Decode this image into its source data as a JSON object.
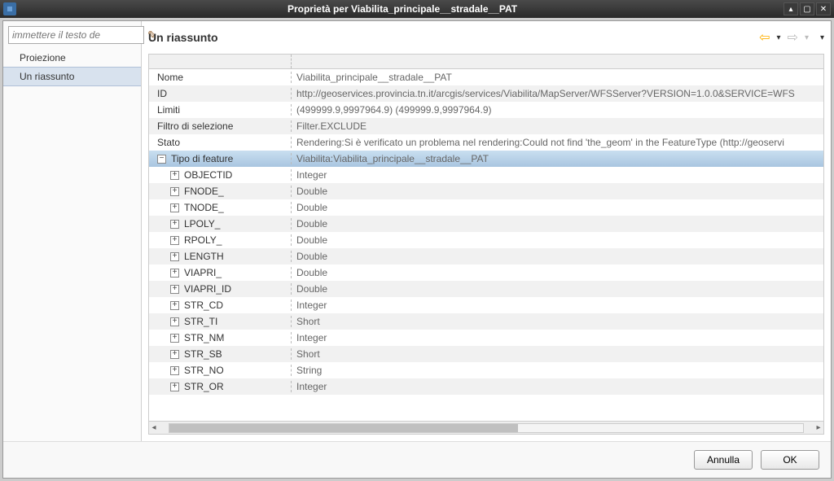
{
  "window": {
    "title": "Proprietà per Viabilita_principale__stradale__PAT"
  },
  "sidebar": {
    "search_placeholder": "immettere il testo de",
    "items": [
      {
        "label": "Proiezione",
        "selected": false
      },
      {
        "label": "Un riassunto",
        "selected": true
      }
    ]
  },
  "main": {
    "title": "Un riassunto",
    "rows": [
      {
        "label": "Nome",
        "value": "Viabilita_principale__stradale__PAT",
        "expander": "",
        "indent": 0
      },
      {
        "label": "ID",
        "value": "http://geoservices.provincia.tn.it/arcgis/services/Viabilita/MapServer/WFSServer?VERSION=1.0.0&SERVICE=WFS",
        "expander": "",
        "indent": 0
      },
      {
        "label": "Limiti",
        "value": "(499999.9,9997964.9) (499999.9,9997964.9)",
        "expander": "",
        "indent": 0
      },
      {
        "label": "Filtro di selezione",
        "value": "Filter.EXCLUDE",
        "expander": "",
        "indent": 0
      },
      {
        "label": "Stato",
        "value": "Rendering:Si è verificato un problema nel rendering:Could not find 'the_geom' in the FeatureType (http://geoservi",
        "expander": "",
        "indent": 0
      },
      {
        "label": "Tipo di feature",
        "value": "Viabilita:Viabilita_principale__stradale__PAT",
        "expander": "−",
        "indent": 0,
        "highlight": true
      },
      {
        "label": "OBJECTID",
        "value": "Integer",
        "expander": "+",
        "indent": 1
      },
      {
        "label": "FNODE_",
        "value": "Double",
        "expander": "+",
        "indent": 1
      },
      {
        "label": "TNODE_",
        "value": "Double",
        "expander": "+",
        "indent": 1
      },
      {
        "label": "LPOLY_",
        "value": "Double",
        "expander": "+",
        "indent": 1
      },
      {
        "label": "RPOLY_",
        "value": "Double",
        "expander": "+",
        "indent": 1
      },
      {
        "label": "LENGTH",
        "value": "Double",
        "expander": "+",
        "indent": 1
      },
      {
        "label": "VIAPRI_",
        "value": "Double",
        "expander": "+",
        "indent": 1
      },
      {
        "label": "VIAPRI_ID",
        "value": "Double",
        "expander": "+",
        "indent": 1
      },
      {
        "label": "STR_CD",
        "value": "Integer",
        "expander": "+",
        "indent": 1
      },
      {
        "label": "STR_TI",
        "value": "Short",
        "expander": "+",
        "indent": 1
      },
      {
        "label": "STR_NM",
        "value": "Integer",
        "expander": "+",
        "indent": 1
      },
      {
        "label": "STR_SB",
        "value": "Short",
        "expander": "+",
        "indent": 1
      },
      {
        "label": "STR_NO",
        "value": "String",
        "expander": "+",
        "indent": 1
      },
      {
        "label": "STR_OR",
        "value": "Integer",
        "expander": "+",
        "indent": 1
      }
    ]
  },
  "buttons": {
    "cancel": "Annulla",
    "ok": "OK"
  }
}
